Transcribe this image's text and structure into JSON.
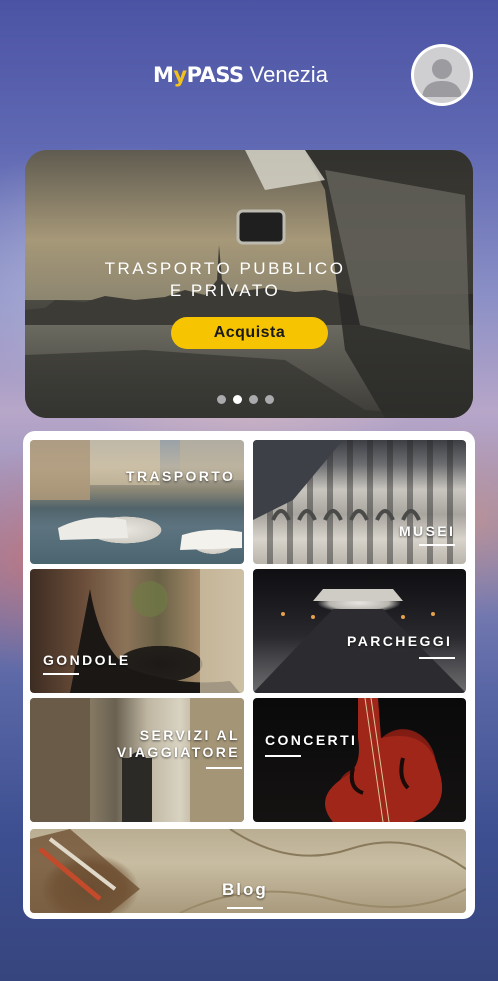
{
  "header": {
    "logo_my": "M",
    "logo_y": "y",
    "logo_pass": "PASS",
    "logo_city": "Venezia",
    "avatar_icon": "user-avatar-icon"
  },
  "hero": {
    "title_line1": "TRASPORTO PUBBLICO",
    "title_line2": "E PRIVATO",
    "button_label": "Acquista",
    "carousel_dots": 4,
    "active_dot": 1
  },
  "tiles": {
    "trasporto": "TRASPORTO",
    "musei": "MUSEI",
    "gondole": "GONDOLE",
    "parcheggi": "PARCHEGGI",
    "servizi_line1": "SERVIZI AL",
    "servizi_line2": "VIAGGIATORE",
    "concerti": "CONCERTI",
    "blog": "Blog"
  },
  "colors": {
    "accent_yellow": "#f6c400",
    "logo_yellow": "#f2c21a",
    "panel": "#ffffff"
  }
}
